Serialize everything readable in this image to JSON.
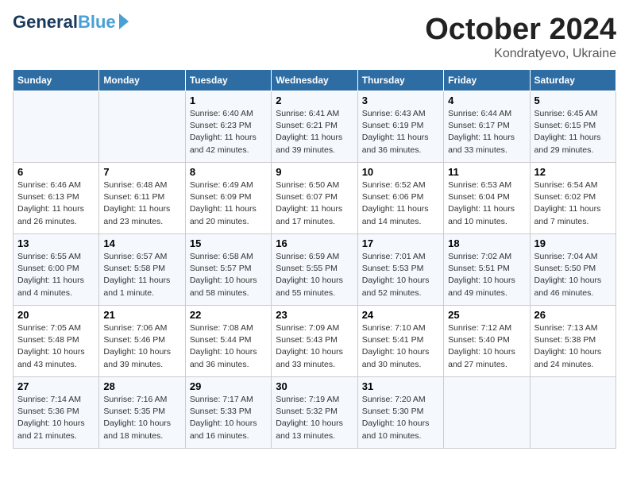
{
  "logo": {
    "line1": "General",
    "line2": "Blue"
  },
  "title": "October 2024",
  "location": "Kondratyevo, Ukraine",
  "days_header": [
    "Sunday",
    "Monday",
    "Tuesday",
    "Wednesday",
    "Thursday",
    "Friday",
    "Saturday"
  ],
  "weeks": [
    [
      {
        "day": "",
        "info": ""
      },
      {
        "day": "",
        "info": ""
      },
      {
        "day": "1",
        "info": "Sunrise: 6:40 AM\nSunset: 6:23 PM\nDaylight: 11 hours and 42 minutes."
      },
      {
        "day": "2",
        "info": "Sunrise: 6:41 AM\nSunset: 6:21 PM\nDaylight: 11 hours and 39 minutes."
      },
      {
        "day": "3",
        "info": "Sunrise: 6:43 AM\nSunset: 6:19 PM\nDaylight: 11 hours and 36 minutes."
      },
      {
        "day": "4",
        "info": "Sunrise: 6:44 AM\nSunset: 6:17 PM\nDaylight: 11 hours and 33 minutes."
      },
      {
        "day": "5",
        "info": "Sunrise: 6:45 AM\nSunset: 6:15 PM\nDaylight: 11 hours and 29 minutes."
      }
    ],
    [
      {
        "day": "6",
        "info": "Sunrise: 6:46 AM\nSunset: 6:13 PM\nDaylight: 11 hours and 26 minutes."
      },
      {
        "day": "7",
        "info": "Sunrise: 6:48 AM\nSunset: 6:11 PM\nDaylight: 11 hours and 23 minutes."
      },
      {
        "day": "8",
        "info": "Sunrise: 6:49 AM\nSunset: 6:09 PM\nDaylight: 11 hours and 20 minutes."
      },
      {
        "day": "9",
        "info": "Sunrise: 6:50 AM\nSunset: 6:07 PM\nDaylight: 11 hours and 17 minutes."
      },
      {
        "day": "10",
        "info": "Sunrise: 6:52 AM\nSunset: 6:06 PM\nDaylight: 11 hours and 14 minutes."
      },
      {
        "day": "11",
        "info": "Sunrise: 6:53 AM\nSunset: 6:04 PM\nDaylight: 11 hours and 10 minutes."
      },
      {
        "day": "12",
        "info": "Sunrise: 6:54 AM\nSunset: 6:02 PM\nDaylight: 11 hours and 7 minutes."
      }
    ],
    [
      {
        "day": "13",
        "info": "Sunrise: 6:55 AM\nSunset: 6:00 PM\nDaylight: 11 hours and 4 minutes."
      },
      {
        "day": "14",
        "info": "Sunrise: 6:57 AM\nSunset: 5:58 PM\nDaylight: 11 hours and 1 minute."
      },
      {
        "day": "15",
        "info": "Sunrise: 6:58 AM\nSunset: 5:57 PM\nDaylight: 10 hours and 58 minutes."
      },
      {
        "day": "16",
        "info": "Sunrise: 6:59 AM\nSunset: 5:55 PM\nDaylight: 10 hours and 55 minutes."
      },
      {
        "day": "17",
        "info": "Sunrise: 7:01 AM\nSunset: 5:53 PM\nDaylight: 10 hours and 52 minutes."
      },
      {
        "day": "18",
        "info": "Sunrise: 7:02 AM\nSunset: 5:51 PM\nDaylight: 10 hours and 49 minutes."
      },
      {
        "day": "19",
        "info": "Sunrise: 7:04 AM\nSunset: 5:50 PM\nDaylight: 10 hours and 46 minutes."
      }
    ],
    [
      {
        "day": "20",
        "info": "Sunrise: 7:05 AM\nSunset: 5:48 PM\nDaylight: 10 hours and 43 minutes."
      },
      {
        "day": "21",
        "info": "Sunrise: 7:06 AM\nSunset: 5:46 PM\nDaylight: 10 hours and 39 minutes."
      },
      {
        "day": "22",
        "info": "Sunrise: 7:08 AM\nSunset: 5:44 PM\nDaylight: 10 hours and 36 minutes."
      },
      {
        "day": "23",
        "info": "Sunrise: 7:09 AM\nSunset: 5:43 PM\nDaylight: 10 hours and 33 minutes."
      },
      {
        "day": "24",
        "info": "Sunrise: 7:10 AM\nSunset: 5:41 PM\nDaylight: 10 hours and 30 minutes."
      },
      {
        "day": "25",
        "info": "Sunrise: 7:12 AM\nSunset: 5:40 PM\nDaylight: 10 hours and 27 minutes."
      },
      {
        "day": "26",
        "info": "Sunrise: 7:13 AM\nSunset: 5:38 PM\nDaylight: 10 hours and 24 minutes."
      }
    ],
    [
      {
        "day": "27",
        "info": "Sunrise: 7:14 AM\nSunset: 5:36 PM\nDaylight: 10 hours and 21 minutes."
      },
      {
        "day": "28",
        "info": "Sunrise: 7:16 AM\nSunset: 5:35 PM\nDaylight: 10 hours and 18 minutes."
      },
      {
        "day": "29",
        "info": "Sunrise: 7:17 AM\nSunset: 5:33 PM\nDaylight: 10 hours and 16 minutes."
      },
      {
        "day": "30",
        "info": "Sunrise: 7:19 AM\nSunset: 5:32 PM\nDaylight: 10 hours and 13 minutes."
      },
      {
        "day": "31",
        "info": "Sunrise: 7:20 AM\nSunset: 5:30 PM\nDaylight: 10 hours and 10 minutes."
      },
      {
        "day": "",
        "info": ""
      },
      {
        "day": "",
        "info": ""
      }
    ]
  ]
}
